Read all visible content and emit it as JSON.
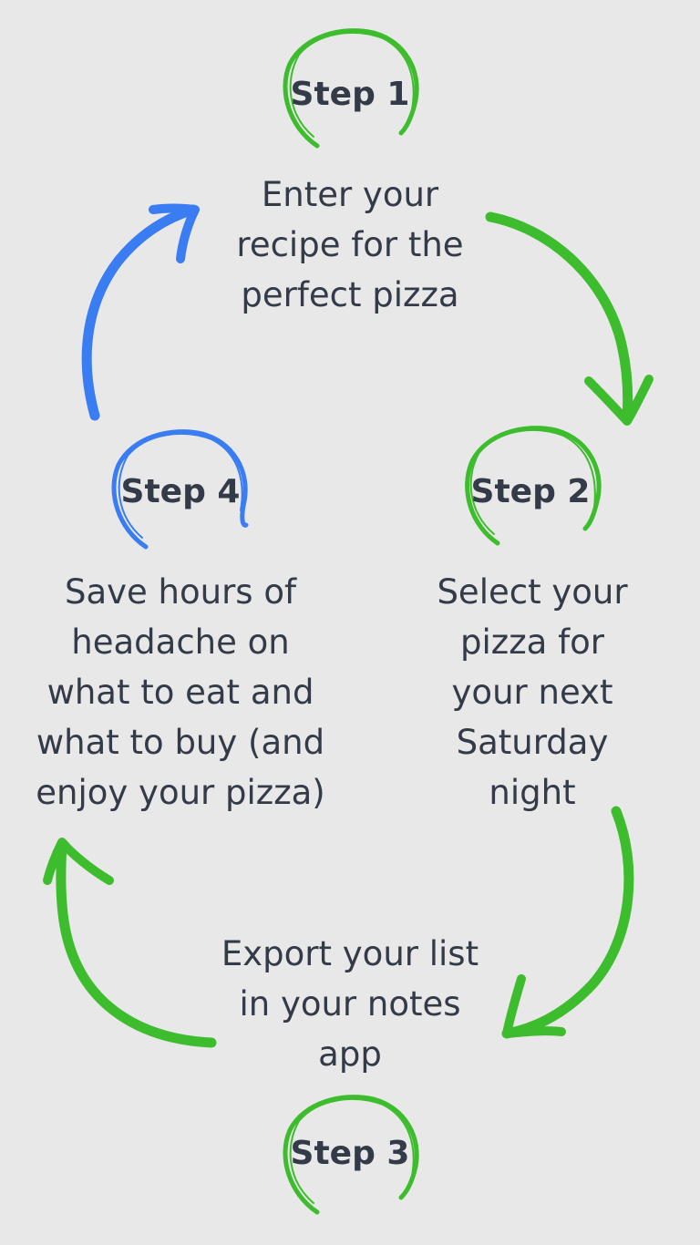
{
  "colors": {
    "background": "#e8e8e8",
    "text": "#333a48",
    "green": "#3dbd2d",
    "blue": "#3a7cf2"
  },
  "steps": [
    {
      "label": "Step 1",
      "description": "Enter your\nrecipe for the\nperfect pizza",
      "color": "#3dbd2d"
    },
    {
      "label": "Step 2",
      "description": "Select your\npizza for\nyour next\nSaturday\nnight",
      "color": "#3dbd2d"
    },
    {
      "label": "Step 3",
      "description": "Export your list\nin your notes\napp",
      "color": "#3dbd2d"
    },
    {
      "label": "Step 4",
      "description": "Save hours of\nheadache on\nwhat to eat and\nwhat to buy (and\nenjoy your pizza)",
      "color": "#3a7cf2"
    }
  ],
  "arrows": [
    {
      "from": "Step 1",
      "to": "Step 2",
      "color": "#3dbd2d"
    },
    {
      "from": "Step 2",
      "to": "Step 3",
      "color": "#3dbd2d"
    },
    {
      "from": "Step 3",
      "to": "Step 4",
      "color": "#3dbd2d"
    },
    {
      "from": "Step 4",
      "to": "Step 1",
      "color": "#3a7cf2"
    }
  ]
}
